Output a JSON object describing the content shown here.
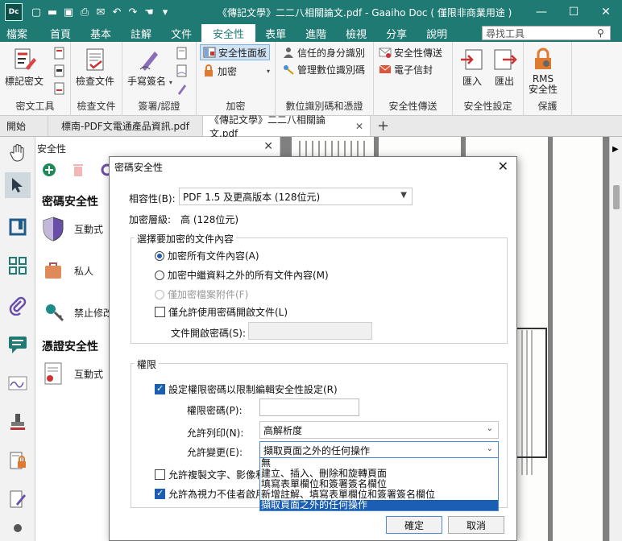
{
  "app": {
    "logo_text": "Dc",
    "title": "《傳記文學》二二八相關論文.pdf - Gaaiho Doc ( 僅限非商業用途 )"
  },
  "menu": {
    "tabs": [
      "檔案",
      "首頁",
      "基本",
      "註解",
      "文件",
      "安全性",
      "表單",
      "進階",
      "檢視",
      "分享",
      "說明"
    ],
    "active": "安全性",
    "search_placeholder": "尋找工具"
  },
  "ribbon": {
    "groups": {
      "stamp": {
        "label": "密文工具",
        "btn": "標記密文"
      },
      "check": {
        "label": "檢查文件",
        "btn": "檢查文件"
      },
      "sign": {
        "label": "簽署/認證",
        "btn": "手寫簽名"
      },
      "encrypt": {
        "label": "加密",
        "panel": "安全性面板",
        "encrypt": "加密"
      },
      "id": {
        "label": "數位識別碼和憑證",
        "trusted": "信任的身分識別",
        "manage": "管理數位識別碼"
      },
      "transfer": {
        "label": "安全性傳送",
        "transfer": "安全性傳送",
        "email": "電子信封"
      },
      "settings": {
        "label": "安全性設定",
        "import": "匯入",
        "export": "匯出"
      },
      "rms": {
        "label": "保護",
        "btn_line1": "RMS",
        "btn_line2": "安全性"
      }
    }
  },
  "doc_tabs": [
    {
      "label": "開始"
    },
    {
      "label": "標南-PDF文電通產品資訊.pdf"
    },
    {
      "label": "《傳記文學》二二八相關論文.pdf"
    }
  ],
  "panel": {
    "title": "安全性",
    "password_section": "密碼安全性",
    "cert_section": "憑證安全性",
    "items": [
      "互動式",
      "私人",
      "禁止修改"
    ],
    "cert_items": [
      "互動式"
    ]
  },
  "dialog": {
    "title": "密碼安全性",
    "compat_label": "相容性(B):",
    "compat_value": "PDF 1.5 及更高版本 (128位元)",
    "level_label": "加密層級:",
    "level_value": "高 (128位元)",
    "content_legend": "選擇要加密的文件內容",
    "radio_all": "加密所有文件內容(A)",
    "radio_except_meta": "加密中繼資料之外的所有文件內容(M)",
    "radio_attach": "僅加密檔案附件(F)",
    "check_open_pw": "僅允許使用密碼開啟文件(L)",
    "open_pw_label": "文件開啟密碼(S):",
    "perm_legend": "權限",
    "check_perm_pw": "設定權限密碼以限制編輯安全性設定(R)",
    "perm_pw_label": "權限密碼(P):",
    "print_label": "允許列印(N):",
    "print_value": "高解析度",
    "change_label": "允許變更(E):",
    "change_value": "擷取頁面之外的任何操作",
    "change_options": [
      "無",
      "建立、插入、刪除和旋轉頁面",
      "填寫表單欄位和簽署簽名欄位",
      "新增註解、填寫表單欄位和簽署簽名欄位",
      "擷取頁面之外的任何操作"
    ],
    "check_copy": "允許複製文字、影像和",
    "check_access": "允許為視力不佳者啟用",
    "ok": "確定",
    "cancel": "取消"
  }
}
